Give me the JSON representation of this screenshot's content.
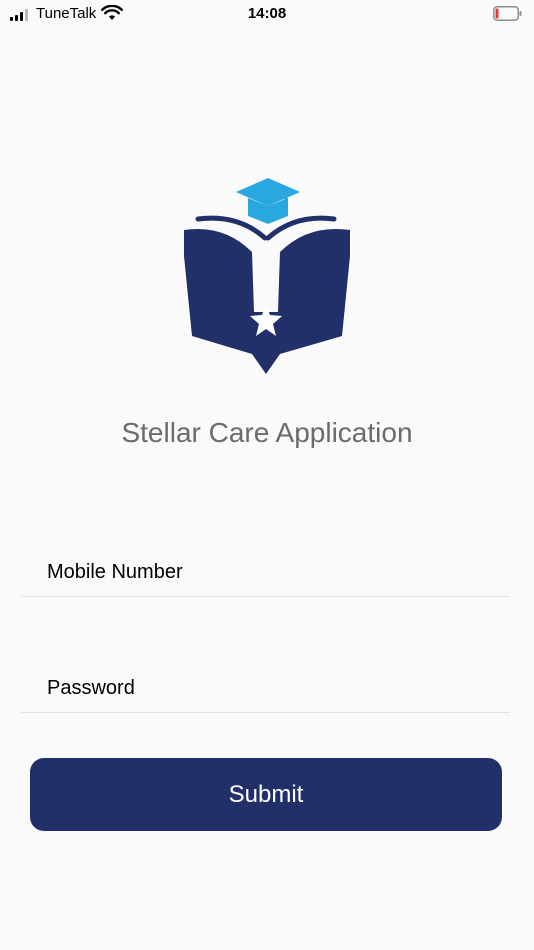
{
  "status_bar": {
    "carrier": "TuneTalk",
    "time": "14:08",
    "battery_level": 0.1
  },
  "app": {
    "title": "Stellar Care Application"
  },
  "form": {
    "mobile_placeholder": "Mobile Number",
    "mobile_value": "",
    "password_placeholder": "Password",
    "password_value": "",
    "submit_label": "Submit"
  },
  "colors": {
    "brand_navy": "#22306a",
    "accent_blue": "#29a8e0",
    "title_gray": "#6b6b6b",
    "battery_red": "#e53935"
  }
}
